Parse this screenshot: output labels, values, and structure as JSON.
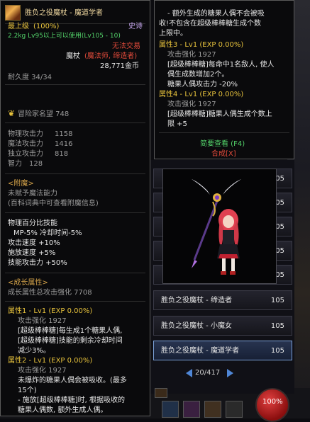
{
  "tooltip": {
    "title": "胜负之役魔杖 - 魔道学者",
    "grade": "最上级",
    "grade_pct": "(100%)",
    "rarity": "史诗",
    "weight_level": "2.2kg  Lv95以上可以使用(Lv105 - 10)",
    "trade": "无法交易",
    "class": "魔杖",
    "class_jobs": "(魔法师, 缔造者)",
    "price": "28,771金币",
    "durability": "耐久度 34/34",
    "adventurer_fame": "冒险家名望 748",
    "stats": [
      {
        "label": "物理攻击力",
        "value": "1158"
      },
      {
        "label": "魔法攻击力",
        "value": "1416"
      },
      {
        "label": "独立攻击力",
        "value": "818"
      },
      {
        "label": "智力",
        "value": "128"
      }
    ],
    "enchant_header": "<附魔>",
    "enchant_lines": [
      "未赋予魔法能力",
      "(百科词典中可查看附魔信息)"
    ],
    "pct_header": "物理百分比技能",
    "pct_lines": [
      "MP-5% 冷却时间-5%",
      "攻击速度 +10%",
      "施放速度 +5%",
      "技能攻击力 +50%"
    ],
    "growth_header": "<成长属性>",
    "growth_total": "成长属性总攻击强化 7708",
    "attr1": {
      "title": "属性1 - Lv1 (EXP 0.00%)",
      "lines": [
        "攻击强化 1927",
        "[超级棒棒糖]每生成1个糖果人偶,",
        "[超级棒棒糖]技能的剩余冷却时间",
        "减少3%。"
      ]
    },
    "attr2": {
      "title": "属性2 - Lv1 (EXP 0.00%)",
      "lines": [
        "攻击强化 1927",
        "未爆炸的糖果人偶会被吸收。(最多",
        "15个)",
        "- 施放[超级棒棒糖]时, 根据吸收的",
        "糖果人偶数, 额外生成人偶。"
      ]
    }
  },
  "tooltip2": {
    "top_lines": [
      "- 额外生成的糖果人偶不会被吸",
      "收!不包含在超级棒棒糖生成个数",
      "上限中。"
    ],
    "attr3": {
      "title": "属性3 - Lv1 (EXP 0.00%)",
      "lines": [
        "攻击强化 1927",
        "[超级棒棒糖]每命中1名敌人, 使人",
        "偶生成数增加2个。",
        "糖果人偶攻击力 -20%"
      ]
    },
    "attr4": {
      "title": "属性4 - Lv1 (EXP 0.00%)",
      "lines": [
        "攻击强化 1927",
        "[超级棒棒糖]糖果人偶生成个数上",
        "限 +5"
      ]
    },
    "brief_link": "简要查看 (F4)",
    "synth_link": "合成[X]"
  },
  "list": {
    "rows": [
      {
        "name": "胜负之役魔杖 - 缔造者",
        "level": "105"
      },
      {
        "name": "胜负之役魔杖 - 小魔女",
        "level": "105"
      },
      {
        "name": "胜负之役魔杖 - 魔道学者",
        "level": "105"
      }
    ],
    "partial_levels": [
      "105",
      "105",
      "105",
      "105",
      "105"
    ],
    "pager": "20/417"
  },
  "hud": {
    "hp_text": "100%"
  },
  "colors": {
    "gold": "#e8c33c",
    "green": "#53d36a",
    "red": "#e04a3a",
    "purple": "#c8a8f0"
  }
}
